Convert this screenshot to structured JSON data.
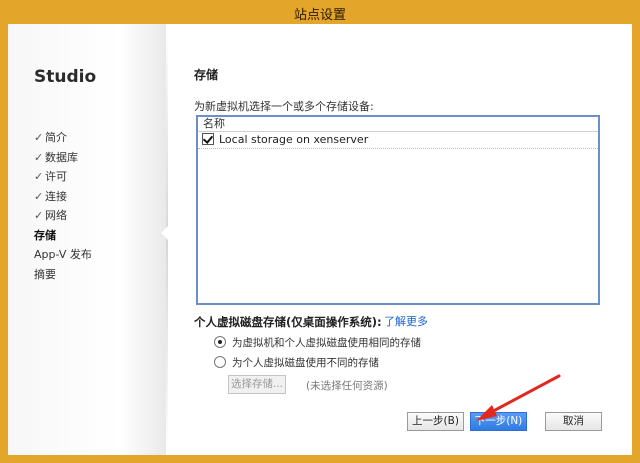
{
  "window": {
    "title": "站点设置"
  },
  "sidebar": {
    "brand": "Studio",
    "items": [
      {
        "label": "简介",
        "checked": true
      },
      {
        "label": "数据库",
        "checked": true
      },
      {
        "label": "许可",
        "checked": true
      },
      {
        "label": "连接",
        "checked": true
      },
      {
        "label": "网络",
        "checked": true
      },
      {
        "label": "存储",
        "active": true
      },
      {
        "label": "App-V 发布"
      },
      {
        "label": "摘要"
      }
    ],
    "check_glyph": "✓"
  },
  "main": {
    "section_title": "存储",
    "select_label": "为新虚拟机选择一个或多个存储设备:",
    "list": {
      "column_header": "名称",
      "rows": [
        {
          "label": "Local storage on xenserver",
          "checked": true
        }
      ]
    },
    "vdisk": {
      "title": "个人虚拟磁盘存储(仅桌面操作系统):",
      "learn_more": "了解更多",
      "options": [
        {
          "label": "为虚拟机和个人虚拟磁盘使用相同的存储",
          "selected": true
        },
        {
          "label": "为个人虚拟磁盘使用不同的存储",
          "selected": false
        }
      ],
      "choose_storage_button": "选择存储...",
      "no_resource_text": "(未选择任何资源)"
    }
  },
  "footer": {
    "back_button": "上一步(B)",
    "next_button": "下一步(N)",
    "cancel_button": "取消"
  },
  "colors": {
    "titlebar": "#e3a52a",
    "accent_blue": "#2f7be3",
    "link_blue": "#1a63c8",
    "annotation_arrow": "#e0281f"
  }
}
